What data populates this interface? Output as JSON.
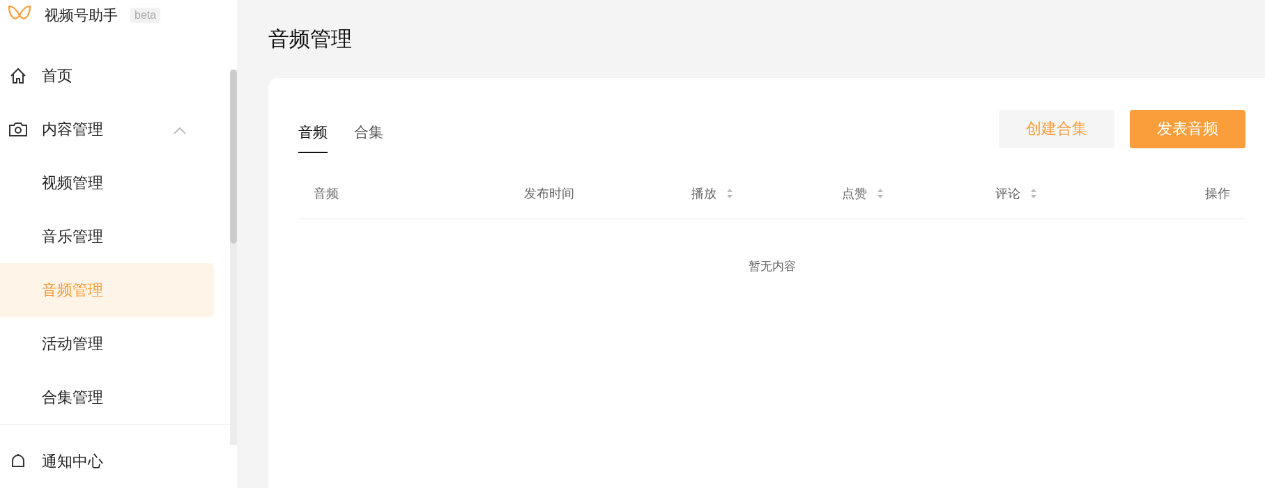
{
  "brand": {
    "name": "视频号助手",
    "badge": "beta"
  },
  "sidebar": {
    "items": [
      {
        "label": "首页",
        "kind": "home",
        "selected": false
      },
      {
        "label": "内容管理",
        "kind": "camera",
        "selected": false,
        "expanded": true,
        "children": [
          {
            "label": "视频管理",
            "selected": false
          },
          {
            "label": "音乐管理",
            "selected": false
          },
          {
            "label": "音频管理",
            "selected": true
          },
          {
            "label": "活动管理",
            "selected": false
          },
          {
            "label": "合集管理",
            "selected": false
          }
        ]
      },
      {
        "label": "通知中心",
        "kind": "bell",
        "selected": false
      }
    ]
  },
  "page": {
    "title": "音频管理"
  },
  "tabs": [
    {
      "label": "音频",
      "selected": true
    },
    {
      "label": "合集",
      "selected": false
    }
  ],
  "buttons": [
    {
      "label": "创建合集",
      "kind": "secondary"
    },
    {
      "label": "发表音频",
      "kind": "primary"
    }
  ],
  "table": {
    "columns": [
      {
        "label": "音频",
        "sortable": false
      },
      {
        "label": "发布时间",
        "sortable": false
      },
      {
        "label": "播放",
        "sortable": true
      },
      {
        "label": "点赞",
        "sortable": true
      },
      {
        "label": "评论",
        "sortable": true
      },
      {
        "label": "操作",
        "sortable": false
      }
    ],
    "empty_text": "暂无内容"
  }
}
